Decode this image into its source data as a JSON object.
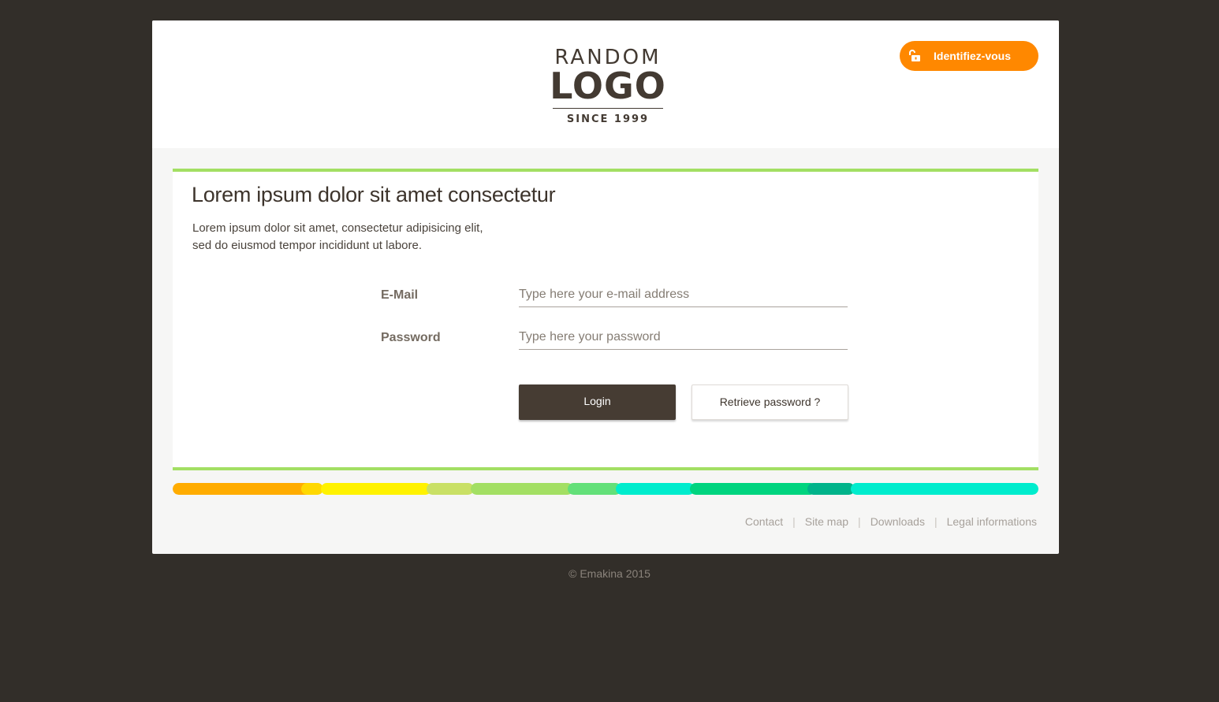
{
  "header": {
    "logo": {
      "top": "RANDOM",
      "main": "LOGO",
      "since": "SINCE 1999"
    },
    "identify_button": {
      "label": "Identifiez-vous",
      "icon": "unlock-icon"
    }
  },
  "main": {
    "title": "Lorem ipsum dolor sit amet consectetur",
    "intro_line1": "Lorem ipsum dolor sit amet, consectetur adipisicing elit,",
    "intro_line2": "sed do eiusmod tempor incididunt ut labore.",
    "form": {
      "email_label": "E-Mail",
      "email_placeholder": "Type here your e-mail address",
      "email_value": "",
      "password_label": "Password",
      "password_placeholder": "Type here your password",
      "password_value": "",
      "login_label": "Login",
      "retrieve_label": "Retrieve password ?"
    }
  },
  "footer": {
    "links": [
      "Contact",
      "Site map",
      "Downloads",
      "Legal informations"
    ],
    "separator": "|",
    "copyright": "© Emakina 2015"
  },
  "colors": {
    "accent_orange": "#ff8800",
    "accent_green": "#a3df63",
    "dark_brown": "#463c33",
    "background": "#322e29",
    "color_bar": [
      "#ffac00",
      "#ffd800",
      "#fff200",
      "#c9e065",
      "#a3df63",
      "#63e079",
      "#00eccd",
      "#00d47f",
      "#00b38a",
      "#00eccd"
    ]
  }
}
